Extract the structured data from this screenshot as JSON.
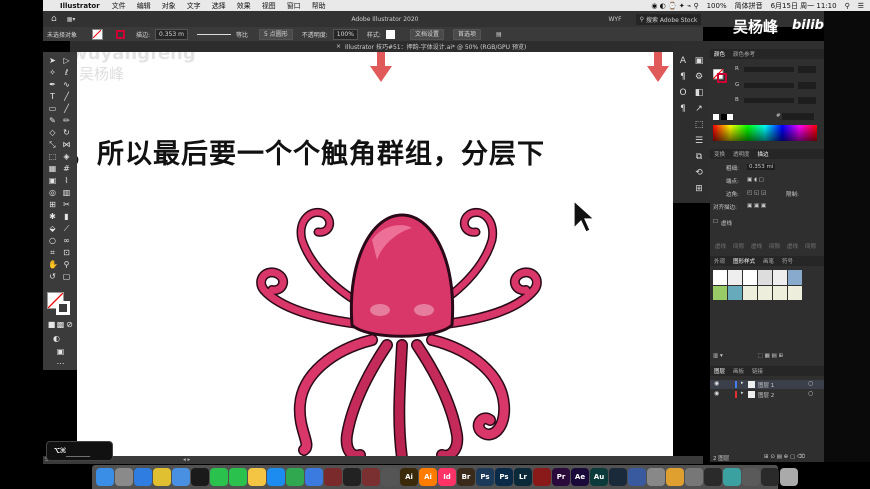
{
  "menubar": {
    "app_name": "Illustrator",
    "items": [
      "文件",
      "编辑",
      "对象",
      "文字",
      "选择",
      "效果",
      "视图",
      "窗口",
      "帮助"
    ],
    "battery": "100%",
    "user_name": "简体拼音",
    "clock": "6月15日 周一 11:10"
  },
  "appbar": {
    "title": "Adobe Illustrator 2020",
    "workspace": "WYF",
    "search_placeholder": "搜索 Adobe Stock"
  },
  "control_bar": {
    "selection_label": "未选择对象",
    "stroke_label": "描边:",
    "stroke_value": "0.353 m",
    "stroke_profile": "等比",
    "brush_label": "5 点圆形",
    "opacity_label": "不透明度:",
    "opacity_value": "100%",
    "style_label": "样式:",
    "doc_setup_button": "文档设置",
    "preferences_button": "首选项"
  },
  "document_tab": {
    "title": "Illustrator 技巧#51：押韵-字体设计.ai* @ 50% (RGB/GPU 预览)"
  },
  "canvas": {
    "watermark_en": "wuyangfeng",
    "watermark_cn": "吴杨峰",
    "headline": "，所以最后要一个个触角群组，分层下",
    "arrow_color": "#e05a5a",
    "octopus_color": "#d9366a"
  },
  "branding": {
    "author": "吴杨峰",
    "site": "bilibili"
  },
  "color_panel": {
    "tabs": [
      "颜色",
      "颜色参考"
    ],
    "channels": [
      "R",
      "G",
      "B"
    ],
    "hex_prefix": "#"
  },
  "stroke_panel": {
    "tabs": [
      "变换",
      "透明度",
      "描边"
    ],
    "weight_label": "粗细:",
    "weight_value": "0.353 mi",
    "cap_label": "端点:",
    "corner_label": "边角:",
    "limit_label": "限制:",
    "align_label": "对齐描边:",
    "dashed_label": "虚线",
    "dash_fields": [
      "虚线",
      "间隙",
      "虚线",
      "间隙",
      "虚线",
      "间隙"
    ]
  },
  "swatch_panel": {
    "tabs": [
      "外观",
      "图形样式",
      "画笔",
      "符号"
    ]
  },
  "layers_panel": {
    "tabs": [
      "图层",
      "画板",
      "链接"
    ],
    "layers": [
      {
        "name": "图层 1",
        "color": "#4a7bf0"
      },
      {
        "name": "图层 2",
        "color": "#e03030"
      }
    ],
    "footer_count": "2 图层"
  },
  "status_bar": {
    "zoom": "50%"
  },
  "keyboard_overlay": {
    "keys": "⌥⌘____"
  },
  "dock": {
    "apps": [
      {
        "name": "Finder",
        "label": "",
        "color": "#3a8ee6"
      },
      {
        "name": "Launchpad",
        "label": "",
        "color": "#8a8a8a"
      },
      {
        "name": "Safari",
        "label": "",
        "color": "#2f7de0"
      },
      {
        "name": "Chrome",
        "label": "",
        "color": "#e0c030"
      },
      {
        "name": "Mail",
        "label": "",
        "color": "#4a90e2"
      },
      {
        "name": "QQ",
        "label": "",
        "color": "#1a1a1a"
      },
      {
        "name": "Messages",
        "label": "",
        "color": "#2ac14d"
      },
      {
        "name": "WeChat",
        "label": "",
        "color": "#2ac14d"
      },
      {
        "name": "Notes",
        "label": "",
        "color": "#f4c542"
      },
      {
        "name": "AppStore",
        "label": "",
        "color": "#1c8cf0"
      },
      {
        "name": "Numbers",
        "label": "",
        "color": "#2fa84f"
      },
      {
        "name": "Keynote",
        "label": "",
        "color": "#3b7be0"
      },
      {
        "name": "Xmind",
        "label": "",
        "color": "#7a2a2a"
      },
      {
        "name": "Terminal",
        "label": "",
        "color": "#222"
      },
      {
        "name": "Dictionary",
        "label": "",
        "color": "#7a3030"
      },
      {
        "name": "Calculator",
        "label": "",
        "color": "#555"
      },
      {
        "name": "Illustrator CS",
        "label": "Ai",
        "color": "#3a2a0a"
      },
      {
        "name": "Illustrator",
        "label": "Ai",
        "color": "#ff7c00"
      },
      {
        "name": "InDesign",
        "label": "Id",
        "color": "#ff3366"
      },
      {
        "name": "Bridge",
        "label": "Br",
        "color": "#3a2a1a"
      },
      {
        "name": "Photoshop",
        "label": "Ps",
        "color": "#1c3a5a"
      },
      {
        "name": "Photoshop 2",
        "label": "Ps",
        "color": "#0a2a4a"
      },
      {
        "name": "Lightroom",
        "label": "Lr",
        "color": "#0a2a3a"
      },
      {
        "name": "Acrobat",
        "label": "",
        "color": "#8a1a1a"
      },
      {
        "name": "Premiere",
        "label": "Pr",
        "color": "#2a0a3a"
      },
      {
        "name": "After Effects",
        "label": "Ae",
        "color": "#1a0a3a"
      },
      {
        "name": "Audition",
        "label": "Au",
        "color": "#0a3a3a"
      },
      {
        "name": "Media Encoder",
        "label": "",
        "color": "#1a2a3a"
      },
      {
        "name": "Cinema",
        "label": "",
        "color": "#3a5aa0"
      },
      {
        "name": "Preview",
        "label": "",
        "color": "#888"
      },
      {
        "name": "Toolbox",
        "label": "",
        "color": "#e0a030"
      },
      {
        "name": "Chrome Canary",
        "label": "",
        "color": "#777"
      },
      {
        "name": "Motion",
        "label": "",
        "color": "#2a2a2a"
      },
      {
        "name": "Maps",
        "label": "",
        "color": "#3aa0a0"
      },
      {
        "name": "Screen Recorder",
        "label": "",
        "color": "#5a5a5a"
      },
      {
        "name": "Activity",
        "label": "",
        "color": "#2a2a2a"
      },
      {
        "name": "Trash",
        "label": "",
        "color": "#aaa"
      }
    ]
  }
}
